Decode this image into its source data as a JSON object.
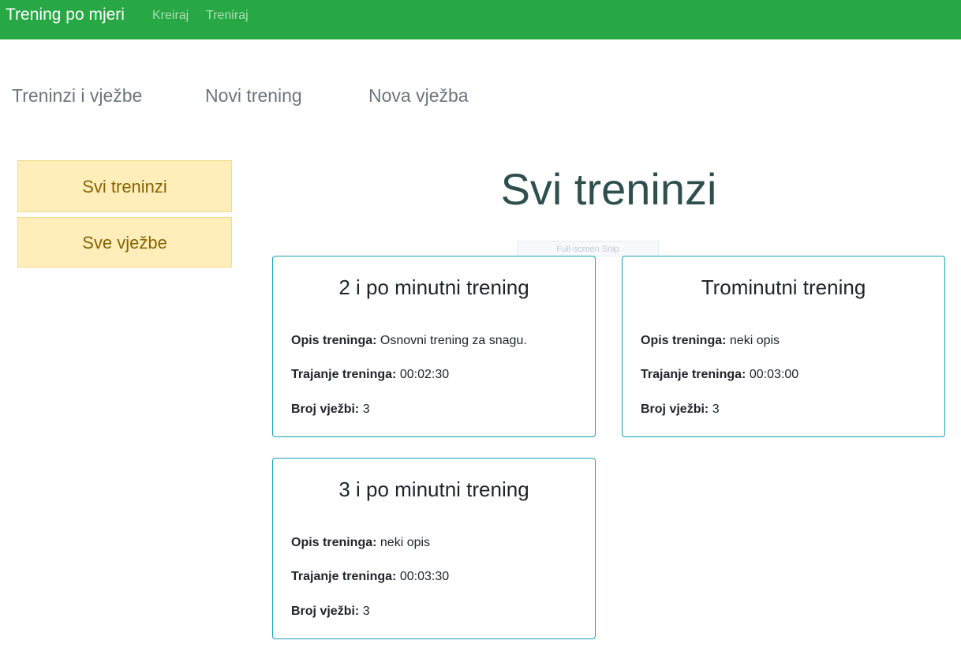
{
  "navbar": {
    "brand": "Trening po mjeri",
    "links": [
      "Kreiraj",
      "Treniraj"
    ]
  },
  "subnav": {
    "tabs": [
      "Treninzi i vježbe",
      "Novi trening",
      "Nova vježba"
    ]
  },
  "sidebar": {
    "buttons": [
      "Svi treninzi",
      "Sve vježbe"
    ]
  },
  "main": {
    "title": "Svi treninzi",
    "snip_overlay": "Full-screen Snip",
    "labels": {
      "opis": "Opis treninga:",
      "trajanje": "Trajanje treninga:",
      "broj": "Broj vježbi:"
    },
    "cards": [
      {
        "title": "2 i po minutni trening",
        "opis": "Osnovni trening za snagu.",
        "trajanje": "00:02:30",
        "broj": "3"
      },
      {
        "title": "Trominutni trening",
        "opis": "neki opis",
        "trajanje": "00:03:00",
        "broj": "3"
      },
      {
        "title": "3 i po minutni trening",
        "opis": "neki opis",
        "trajanje": "00:03:30",
        "broj": "3"
      }
    ]
  },
  "colors": {
    "navbar_bg": "#28a745",
    "card_border": "#17a2b8",
    "sidebar_button_bg": "#ffeeba",
    "sidebar_button_text": "#856404"
  }
}
